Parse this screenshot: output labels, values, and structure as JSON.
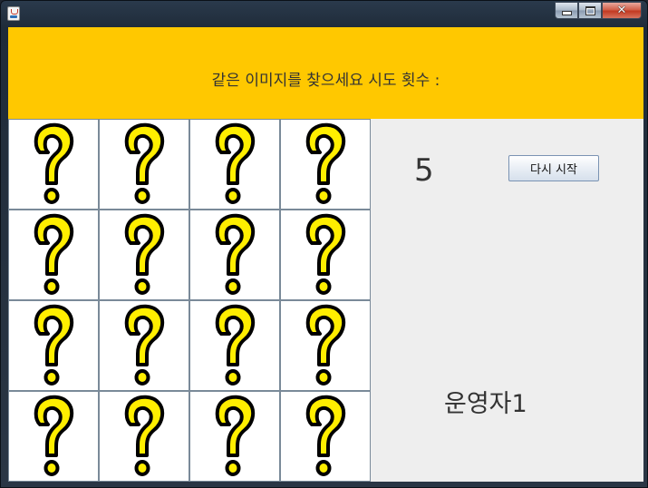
{
  "window": {
    "title": "",
    "minimize_icon": "minimize-icon",
    "maximize_icon": "maximize-icon",
    "close_icon": "close-icon",
    "close_glyph": "✕"
  },
  "header": {
    "text": "같은 이미지를 찾으세요 시도 횟수 :",
    "background": "#ffc800"
  },
  "board": {
    "rows": 4,
    "cols": 4,
    "card_icon": "question-mark-icon",
    "card_color": "#ffee00"
  },
  "side_panel": {
    "attempts": "5",
    "restart_label": "다시 시작",
    "operator_label": "운영자1"
  }
}
